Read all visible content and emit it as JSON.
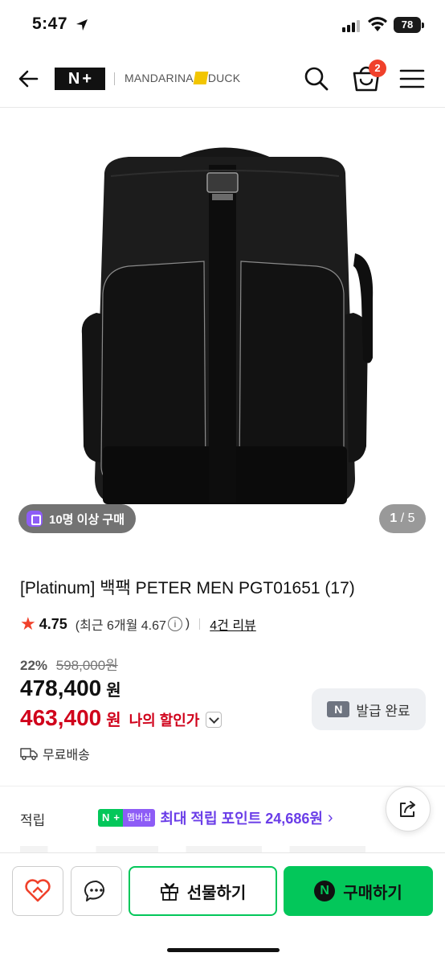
{
  "status_bar": {
    "time": "5:47",
    "battery": "78"
  },
  "header": {
    "brand_left": "MANDARINA",
    "brand_right": "DUCK",
    "cart_count": "2"
  },
  "gallery": {
    "buyers_chip": "10명 이상 구매",
    "page_current": "1",
    "page_total": "/ 5"
  },
  "product": {
    "title": "[Platinum] 백팩 PETER MEN PGT01651 (17)",
    "rating": "4.75",
    "recent_rating": "(최근 6개월 4.67",
    "recent_close": ")",
    "review_count": "4건 리뷰",
    "discount_rate": "22%",
    "original_price": "598,000원",
    "price": "478,400",
    "price_unit": "원",
    "my_price": "463,400",
    "my_price_unit": "원",
    "my_price_label": "나의 할인가",
    "coupon_label": "발급 완료",
    "shipping": "무료배송"
  },
  "reward": {
    "label": "적립",
    "membership": "멤버십",
    "text": "최대 적립 포인트 24,686원"
  },
  "bottom_bar": {
    "gift_label": "선물하기",
    "buy_label": "구매하기"
  },
  "colors": {
    "naver_green": "#03c75a",
    "sale_red": "#d0021b",
    "accent_purple": "#6a3de8",
    "badge_red": "#f0412b"
  }
}
